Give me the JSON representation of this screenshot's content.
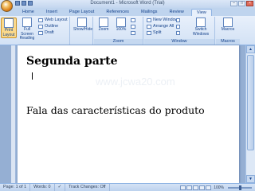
{
  "window": {
    "title": "Document1 - Microsoft Word (Trial)"
  },
  "tabs": [
    "Home",
    "Insert",
    "Page Layout",
    "References",
    "Mailings",
    "Review",
    "View"
  ],
  "active_tab": "View",
  "ribbon": {
    "document_views": {
      "print_layout": "Print Layout",
      "full_screen_reading": "Full Screen Reading",
      "web_layout": "Web Layout",
      "outline": "Outline",
      "draft": "Draft"
    },
    "show_hide": "Show/Hide",
    "zoom_group": {
      "zoom": "Zoom",
      "percent": "100%",
      "label": "Zoom"
    },
    "window_group": {
      "new_window": "New Window",
      "arrange_all": "Arrange All",
      "split": "Split",
      "switch_windows": "Switch Windows",
      "label": "Window"
    },
    "macros_group": {
      "macros": "Macros",
      "label": "Macros"
    }
  },
  "document": {
    "heading": "Segunda parte",
    "watermark": "www.jcwa20.com",
    "body": "Fala das características do produto"
  },
  "statusbar": {
    "page": "Page: 1 of 1",
    "words": "Words: 0",
    "track_changes": "Track Changes: Off",
    "zoom": "100%"
  }
}
